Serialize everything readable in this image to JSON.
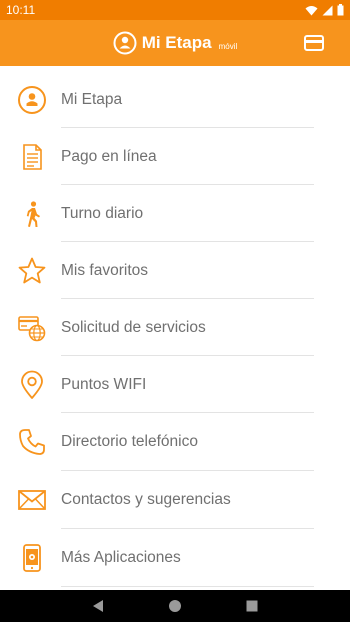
{
  "status_bar": {
    "time": "10:11"
  },
  "app_bar": {
    "title": "Mi Etapa",
    "subtitle": "móvil"
  },
  "menu": {
    "items": [
      {
        "label": "Mi Etapa",
        "icon": "user-circle-icon"
      },
      {
        "label": "Pago en línea",
        "icon": "document-icon"
      },
      {
        "label": "Turno diario",
        "icon": "walking-person-icon"
      },
      {
        "label": "Mis favoritos",
        "icon": "star-icon"
      },
      {
        "label": "Solicitud de servicios",
        "icon": "card-globe-icon"
      },
      {
        "label": "Puntos WIFI",
        "icon": "location-pin-icon"
      },
      {
        "label": "Directorio telefónico",
        "icon": "phone-icon"
      },
      {
        "label": "Contactos y sugerencias",
        "icon": "envelope-icon"
      },
      {
        "label": "Más Aplicaciones",
        "icon": "mobile-app-icon"
      }
    ]
  },
  "colors": {
    "accent": "#f7941d",
    "status": "#f07d00",
    "text": "#707070"
  }
}
